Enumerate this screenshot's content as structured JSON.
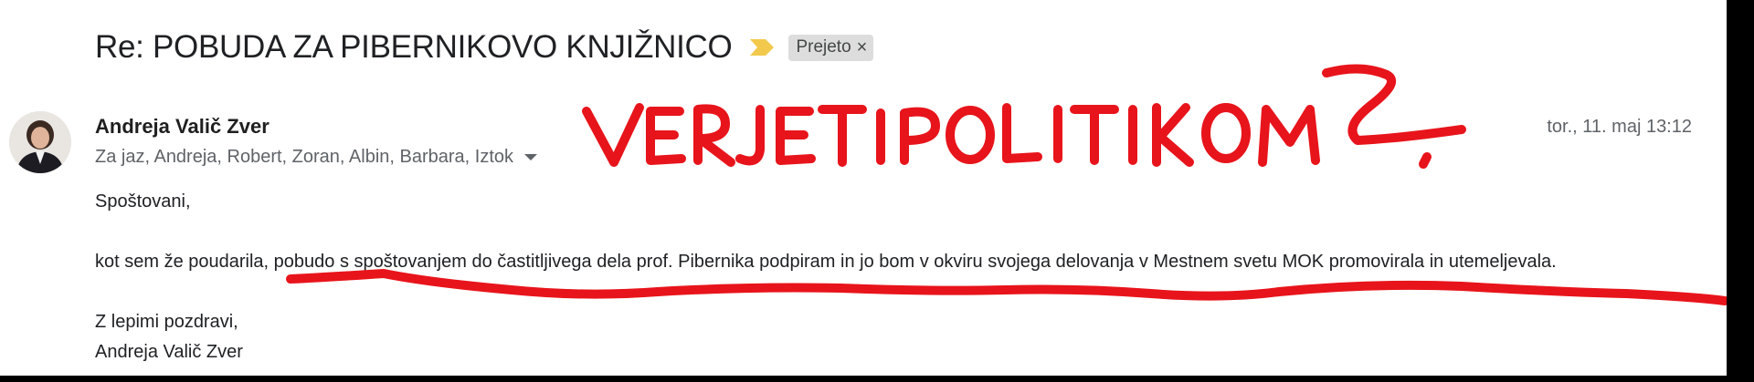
{
  "email": {
    "subject": "Re: POBUDA ZA PIBERNIKOVO KNJIŽNICO",
    "label": "Prejeto",
    "label_remove": "×",
    "sender_name": "Andreja Valič Zver",
    "recipients": "Za jaz, Andreja, Robert, Zoran, Albin, Barbara, Iztok",
    "date": "tor., 11. maj 13:12",
    "body": {
      "greeting": "Spoštovani,",
      "paragraph": "kot sem že poudarila, pobudo s spoštovanjem do častitljivega dela prof. Pibernika podpiram in jo bom v okviru svojega delovanja v Mestnem svetu MOK promovirala in utemeljevala.",
      "closing": "Z lepimi pozdravi,",
      "signature": "Andreja Valič Zver"
    }
  },
  "annotation": {
    "handwritten_text": "VERJETI POLITIKOM?",
    "color": "#e8141b"
  },
  "icons": {
    "importance": "importance-marker-icon",
    "dropdown": "chevron-down-icon",
    "remove_label": "close-icon"
  },
  "colors": {
    "importance_marker": "#f2c94c",
    "chip_bg": "#dddddd",
    "muted_text": "#5f6368"
  }
}
